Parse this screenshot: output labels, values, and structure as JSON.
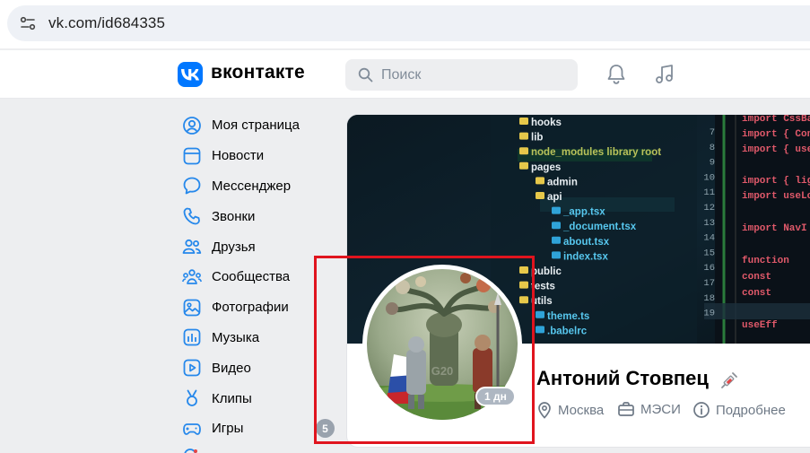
{
  "browser": {
    "url": "vk.com/id684335"
  },
  "header": {
    "wordmark": "вконтакте",
    "search_placeholder": "Поиск"
  },
  "sidebar": {
    "items": [
      {
        "label": "Моя страница",
        "icon": "user-circle-icon"
      },
      {
        "label": "Новости",
        "icon": "news-icon"
      },
      {
        "label": "Мессенджер",
        "icon": "message-icon"
      },
      {
        "label": "Звонки",
        "icon": "phone-icon"
      },
      {
        "label": "Друзья",
        "icon": "friends-icon"
      },
      {
        "label": "Сообщества",
        "icon": "communities-icon"
      },
      {
        "label": "Фотографии",
        "icon": "photo-icon"
      },
      {
        "label": "Музыка",
        "icon": "music-icon"
      },
      {
        "label": "Видео",
        "icon": "video-icon"
      },
      {
        "label": "Клипы",
        "icon": "clips-icon"
      },
      {
        "label": "Игры",
        "icon": "games-icon"
      }
    ],
    "counter": "5"
  },
  "cover": {
    "code_lines": [
      "hooks",
      "lib",
      "node_modules library root",
      "pages",
      "admin",
      "api",
      "_app.tsx",
      "_document.tsx",
      "about.tsx",
      "index.tsx",
      "public",
      "tests",
      "utils",
      "theme.ts",
      ".babelrc"
    ],
    "line_numbers": [
      "7",
      "8",
      "9",
      "10",
      "11",
      "12",
      "13",
      "14",
      "15",
      "16",
      "17",
      "18",
      "19"
    ],
    "right_code": [
      "import CssBase",
      "import { Conte",
      "import { useA",
      "import { lig",
      "import useLo",
      "import NavI",
      "function",
      "const",
      "const",
      "useEff"
    ]
  },
  "profile": {
    "name": "Антоний Стовпец",
    "online": "1 дн",
    "city": "Москва",
    "education": "МЭСИ",
    "more": "Подробнее"
  },
  "colors": {
    "accent": "#0077ff",
    "highlight": "#e0141e"
  }
}
